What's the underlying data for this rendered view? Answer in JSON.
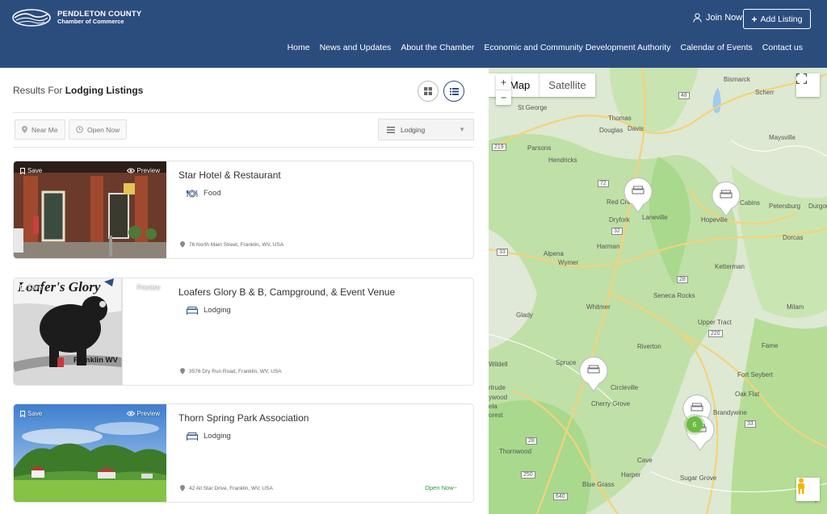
{
  "header": {
    "logo_line1": "PENDLETON COUNTY",
    "logo_line2": "Chamber of Commerce",
    "join_label": "Join Now",
    "add_listing_label": "Add Listing",
    "nav": [
      "Home",
      "News and Updates",
      "About the Chamber",
      "Economic and Community Development Authority",
      "Calendar of Events",
      "Contact us"
    ]
  },
  "results": {
    "prefix": "Results For",
    "category": "Lodging Listings"
  },
  "filters": {
    "near_me": "Near Me",
    "open_now": "Open Now",
    "select_value": "Lodging"
  },
  "listings": [
    {
      "save": "Save",
      "preview": "Preview",
      "title": "Star Hotel & Restaurant",
      "category": "Food",
      "address": "76 North Main Street, Franklin, WV, USA"
    },
    {
      "save": "Save",
      "preview": "Preview",
      "title": "Loafers Glory B & B, Campground, & Event Venue",
      "category": "Lodging",
      "address": "3576 Dry Run Road, Franklin, WV, USA",
      "image_text_top": "Loafer's Glory",
      "image_text_bottom": "Franklin WV"
    },
    {
      "save": "Save",
      "preview": "Preview",
      "title": "Thorn Spring Park Association",
      "category": "Lodging",
      "address": "42 All Star Drive, Franklin, WV, USA",
      "status": "Open Now~"
    }
  ],
  "map": {
    "type_map": "Map",
    "type_satellite": "Satellite",
    "zoom_in": "+",
    "zoom_out": "−",
    "cluster_count": "6",
    "places": [
      "Bismarck",
      "Scherr",
      "St George",
      "Thomas",
      "Davis",
      "Douglas",
      "Parsons",
      "Maysville",
      "Hendricks",
      "Red Creek",
      "Laneville",
      "Cabins",
      "Hopeville",
      "Petersburg",
      "Durgon",
      "Dryfork",
      "Dorcas",
      "Harman",
      "Alpena",
      "Wymer",
      "Ketterman",
      "Seneca Rocks",
      "Whitmer",
      "Petersburg",
      "Glady",
      "Milam",
      "Upper Tract",
      "Riverton",
      "Fame",
      "Spruce",
      "Wildell",
      "Circleville",
      "Fort Seybert",
      "Oak Flat",
      "rtrude",
      "ywood",
      "ela",
      "orest",
      "Cherry Grove",
      "Brandywine",
      "Thornwood",
      "Cave",
      "Harper",
      "Blue Grass",
      "Sugar Grove",
      "Bartley"
    ],
    "routes": [
      "48",
      "219",
      "72",
      "32",
      "33",
      "28",
      "220",
      "250",
      "640",
      "33",
      "28"
    ],
    "colors": {
      "land": "#cfe8b8",
      "green": "#a8d98d",
      "road": "#f5d27a"
    }
  },
  "colors": {
    "header_bg": "#2b4d7e",
    "pin": "#ffffff",
    "cluster": "#6dbb45",
    "open_now": "#2e9a3d"
  }
}
